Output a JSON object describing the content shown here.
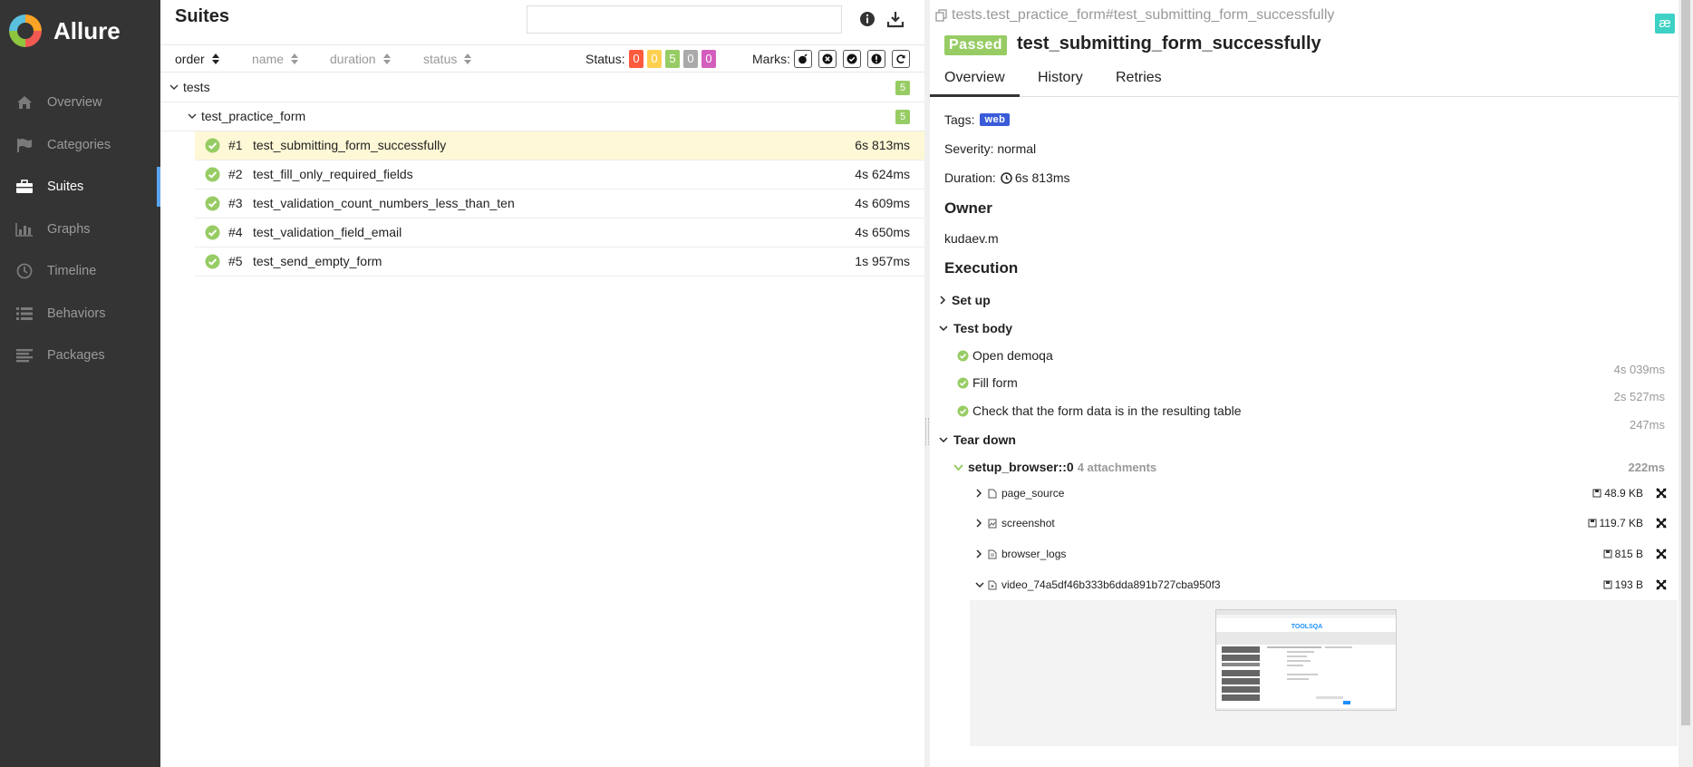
{
  "app": {
    "name": "Allure"
  },
  "sidebar": {
    "items": [
      {
        "label": "Overview",
        "icon": "home-icon"
      },
      {
        "label": "Categories",
        "icon": "flag-icon"
      },
      {
        "label": "Suites",
        "icon": "briefcase-icon",
        "active": true
      },
      {
        "label": "Graphs",
        "icon": "bar-chart-icon"
      },
      {
        "label": "Timeline",
        "icon": "clock-icon"
      },
      {
        "label": "Behaviors",
        "icon": "list-icon"
      },
      {
        "label": "Packages",
        "icon": "align-left-icon"
      }
    ]
  },
  "suites": {
    "title": "Suites",
    "search": {
      "value": "",
      "placeholder": ""
    },
    "columns": {
      "order": "order",
      "name": "name",
      "duration": "duration",
      "status": "status"
    },
    "status_label": "Status:",
    "status_counts": [
      {
        "value": "0",
        "color": "#fd5a3e"
      },
      {
        "value": "0",
        "color": "#ffd050"
      },
      {
        "value": "5",
        "color": "#97cc64"
      },
      {
        "value": "0",
        "color": "#aaaaaa"
      },
      {
        "value": "0",
        "color": "#d35ebe"
      }
    ],
    "marks_label": "Marks:",
    "tree": {
      "root": {
        "label": "tests",
        "count": "5"
      },
      "child": {
        "label": "test_practice_form",
        "count": "5"
      },
      "tests": [
        {
          "num": "#1",
          "name": "test_submitting_form_successfully",
          "duration": "6s 813ms",
          "selected": true
        },
        {
          "num": "#2",
          "name": "test_fill_only_required_fields",
          "duration": "4s 624ms"
        },
        {
          "num": "#3",
          "name": "test_validation_count_numbers_less_than_ten",
          "duration": "4s 609ms"
        },
        {
          "num": "#4",
          "name": "test_validation_field_email",
          "duration": "4s 650ms"
        },
        {
          "num": "#5",
          "name": "test_send_empty_form",
          "duration": "1s 957ms"
        }
      ]
    }
  },
  "detail": {
    "breadcrumb": "tests.test_practice_form#test_submitting_form_successfully",
    "status": "Passed",
    "title": "test_submitting_form_successfully",
    "tabs": [
      "Overview",
      "History",
      "Retries"
    ],
    "tags_label": "Tags:",
    "tag": "web",
    "severity": "Severity: normal",
    "duration_label": "Duration:",
    "duration": "6s 813ms",
    "owner_heading": "Owner",
    "owner": "kudaev.m",
    "execution_heading": "Execution",
    "setup": "Set up",
    "test_body": "Test body",
    "steps": [
      {
        "name": "Open demoqa",
        "duration": "4s 039ms"
      },
      {
        "name": "Fill form",
        "duration": "2s 527ms"
      },
      {
        "name": "Check that the form data is in the resulting table",
        "duration": "247ms"
      }
    ],
    "teardown": "Tear down",
    "fixture": {
      "name": "setup_browser::0",
      "attachments": "4 attachments",
      "duration": "222ms"
    },
    "attachments": [
      {
        "name": "page_source",
        "size": "48.9 KB"
      },
      {
        "name": "screenshot",
        "size": "119.7 KB"
      },
      {
        "name": "browser_logs",
        "size": "815 B"
      },
      {
        "name": "video_74a5df46b333b6dda891b727cba950f3",
        "size": "193 B"
      }
    ],
    "video_logo": "TOOLSQA"
  },
  "colors": {
    "passed": "#97cc64",
    "sidebar": "#343434",
    "accent": "#5ba6f0",
    "tag": "#3b5cd9"
  }
}
